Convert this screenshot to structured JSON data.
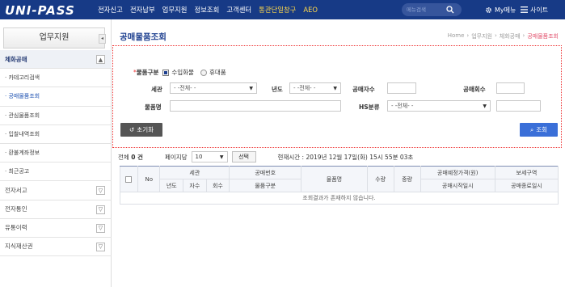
{
  "brand": {
    "logo_text": "UNI-PASS"
  },
  "topnav": {
    "items": [
      "전자신고",
      "전자납부",
      "업무지원",
      "정보조회",
      "고객센터",
      "통관단일창구",
      "AEO"
    ],
    "search_placeholder": "메뉴검색",
    "mymenu": "My메뉴",
    "sitemap": "사이트"
  },
  "sidebar": {
    "title": "업무지원",
    "collapse_glyph": "◂",
    "items": [
      {
        "label": "체화공매",
        "type": "group",
        "toggle": "▲"
      },
      {
        "label": "· 카테고리검색",
        "type": "sub"
      },
      {
        "label": "· 공매물품조회",
        "type": "sub"
      },
      {
        "label": "· 관심물품조회",
        "type": "sub"
      },
      {
        "label": "· 입찰내역조회",
        "type": "sub"
      },
      {
        "label": "· 환불계좌정보",
        "type": "sub"
      },
      {
        "label": "· 최근공고",
        "type": "sub"
      },
      {
        "label": "전자서고",
        "type": "top",
        "toggle": "▽"
      },
      {
        "label": "전자통인",
        "type": "top",
        "toggle": "▽"
      },
      {
        "label": "유통이력",
        "type": "top",
        "toggle": "▽"
      },
      {
        "label": "지식재산권",
        "type": "top",
        "toggle": "▽"
      }
    ]
  },
  "page": {
    "title": "공매물품조회",
    "breadcrumb": [
      "Home",
      "›",
      "업무지원",
      "›",
      "체화공매",
      "›",
      "공매물품조회"
    ]
  },
  "form": {
    "goods_type_label": "물품구분",
    "required_mark": "*",
    "opt_import": "수입화물",
    "opt_carry": "휴대품",
    "customs_label": "세관",
    "customs_value": "- -전체- -",
    "year_label": "년도",
    "year_value": "- -전체- -",
    "times_label": "공매자수",
    "round_label": "공매회수",
    "item_name_label": "물품명",
    "hs_label": "HS분류",
    "hs_value": "- -전체- -",
    "dropdown_glyph": "▼"
  },
  "buttons": {
    "reset": "초기화",
    "reset_icon": "↺",
    "search": "조회",
    "search_icon": "⌕"
  },
  "results": {
    "total_label": "전체",
    "total_count": "0 건",
    "per_page_label": "페이지당",
    "per_page_value": "10",
    "select_button": "선택",
    "now_time": "현재시간 : 2019년 12월 17일(화) 15시 55분 03초"
  },
  "table": {
    "headers_row1": [
      "No",
      "세관",
      "공매번호",
      "물품명",
      "수량",
      "중량",
      "공매예정가격(원)",
      "보세구역"
    ],
    "headers_row2": [
      "년도",
      "자수",
      "회수",
      "물품구분",
      "공매시작일시",
      "공매종료일시"
    ],
    "empty_message": "조회결과가 존재하지 않습니다."
  },
  "colors": {
    "nav_bg": "#173a86",
    "accent": "#1d3f8f",
    "highlight_border": "#e33333",
    "search_button": "#3a6fd8"
  }
}
